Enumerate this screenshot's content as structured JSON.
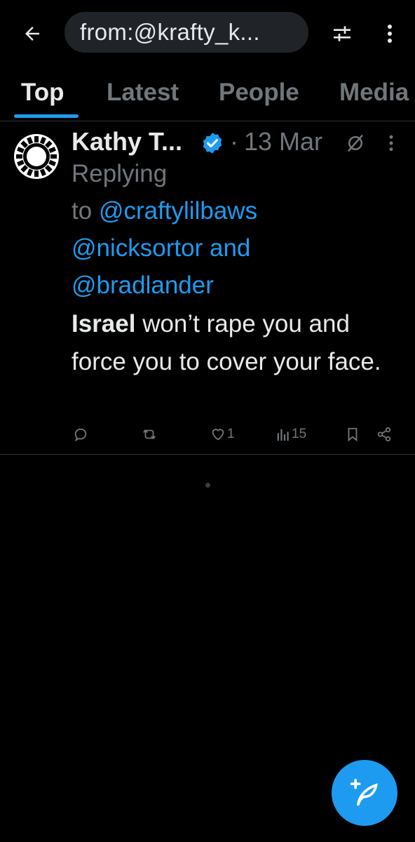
{
  "header": {
    "search_query": "from:@krafty_k...",
    "back_icon": "arrow-left-icon",
    "filter_icon": "sliders-icon",
    "more_icon": "more-vertical-icon"
  },
  "tabs": [
    {
      "label": "Top",
      "active": true
    },
    {
      "label": "Latest",
      "active": false
    },
    {
      "label": "People",
      "active": false
    },
    {
      "label": "Media",
      "active": false
    }
  ],
  "tweet": {
    "author": "Kathy T...",
    "verified": true,
    "separator": "·",
    "date": "13 Mar",
    "replying_prefix": "Replying",
    "replying_to_word": "to",
    "mentions": [
      "@craftylilbaws",
      "@nicksortor",
      "@bradlander"
    ],
    "mention_joiner": "and",
    "text_bold": "Israel",
    "text_rest": " won’t rape you and force you to cover your face.",
    "actions": {
      "reply_count": "",
      "retweet_count": "",
      "like_count": "1",
      "views_count": "15"
    }
  },
  "colors": {
    "background": "#000000",
    "accent": "#1d9bf0",
    "muted": "#71767b",
    "text": "#e7e9ea"
  },
  "fab": {
    "icon": "compose-post-icon"
  }
}
